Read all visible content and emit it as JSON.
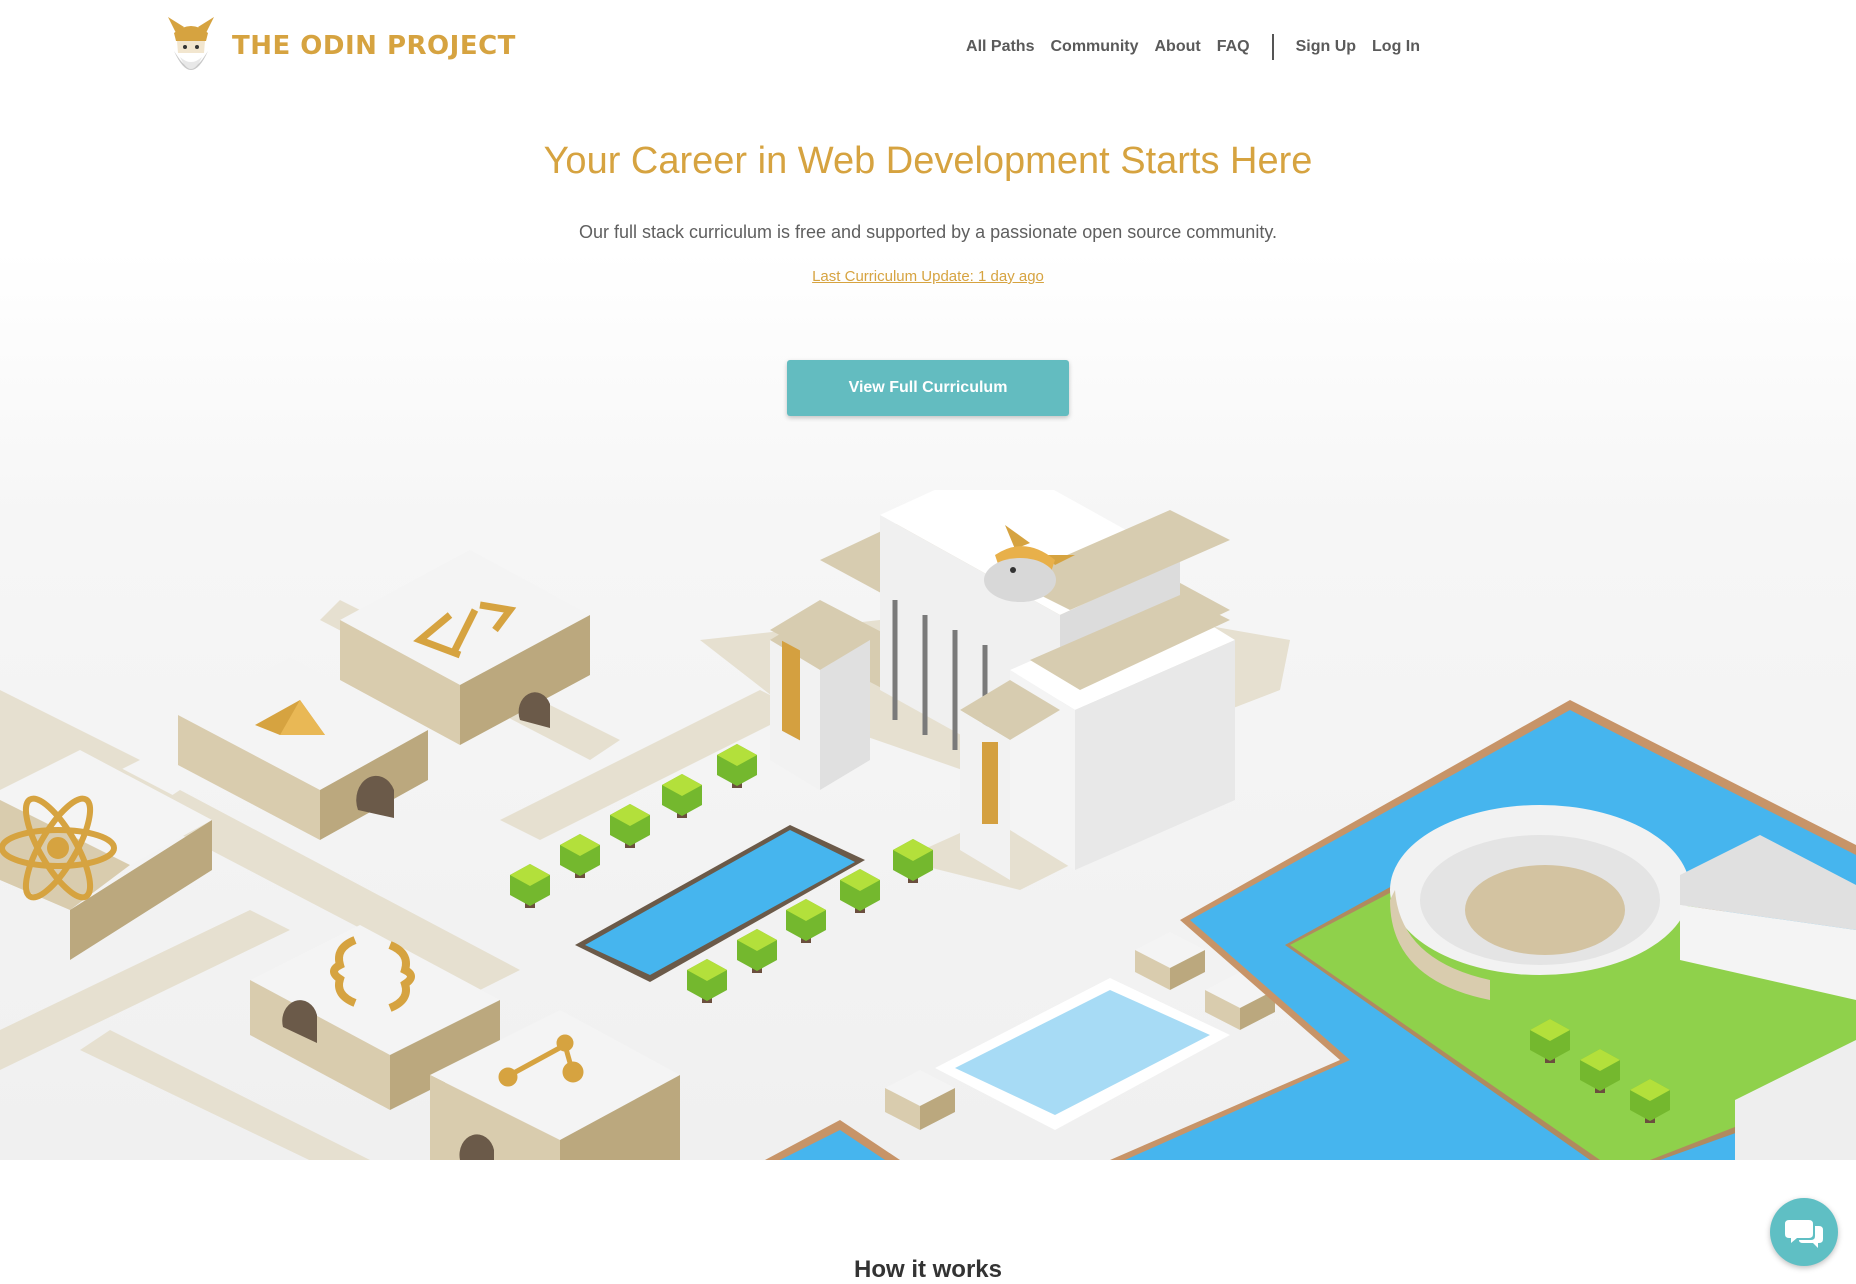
{
  "brand": {
    "name": "THE ODIN PROJECT",
    "color": "#d6a340"
  },
  "nav": {
    "items": [
      {
        "label": "All Paths"
      },
      {
        "label": "Community"
      },
      {
        "label": "About"
      },
      {
        "label": "FAQ"
      }
    ],
    "sign_up": "Sign Up",
    "log_in": "Log In"
  },
  "hero": {
    "title": "Your Career in Web Development Starts Here",
    "subtitle": "Our full stack curriculum is free and supported by a passionate open source community.",
    "update_link": "Last Curriculum Update: 1 day ago",
    "cta_label": "View Full Curriculum",
    "cta_color": "#63bcc0"
  },
  "illustration": {
    "icons": [
      "react-atom-icon",
      "curly-braces-icon",
      "html-tags-icon",
      "gem-icon",
      "git-branch-icon",
      "odin-helmet-icon"
    ]
  },
  "section": {
    "heading": "How it works"
  },
  "chat": {
    "icon": "chat-bubbles-icon"
  }
}
